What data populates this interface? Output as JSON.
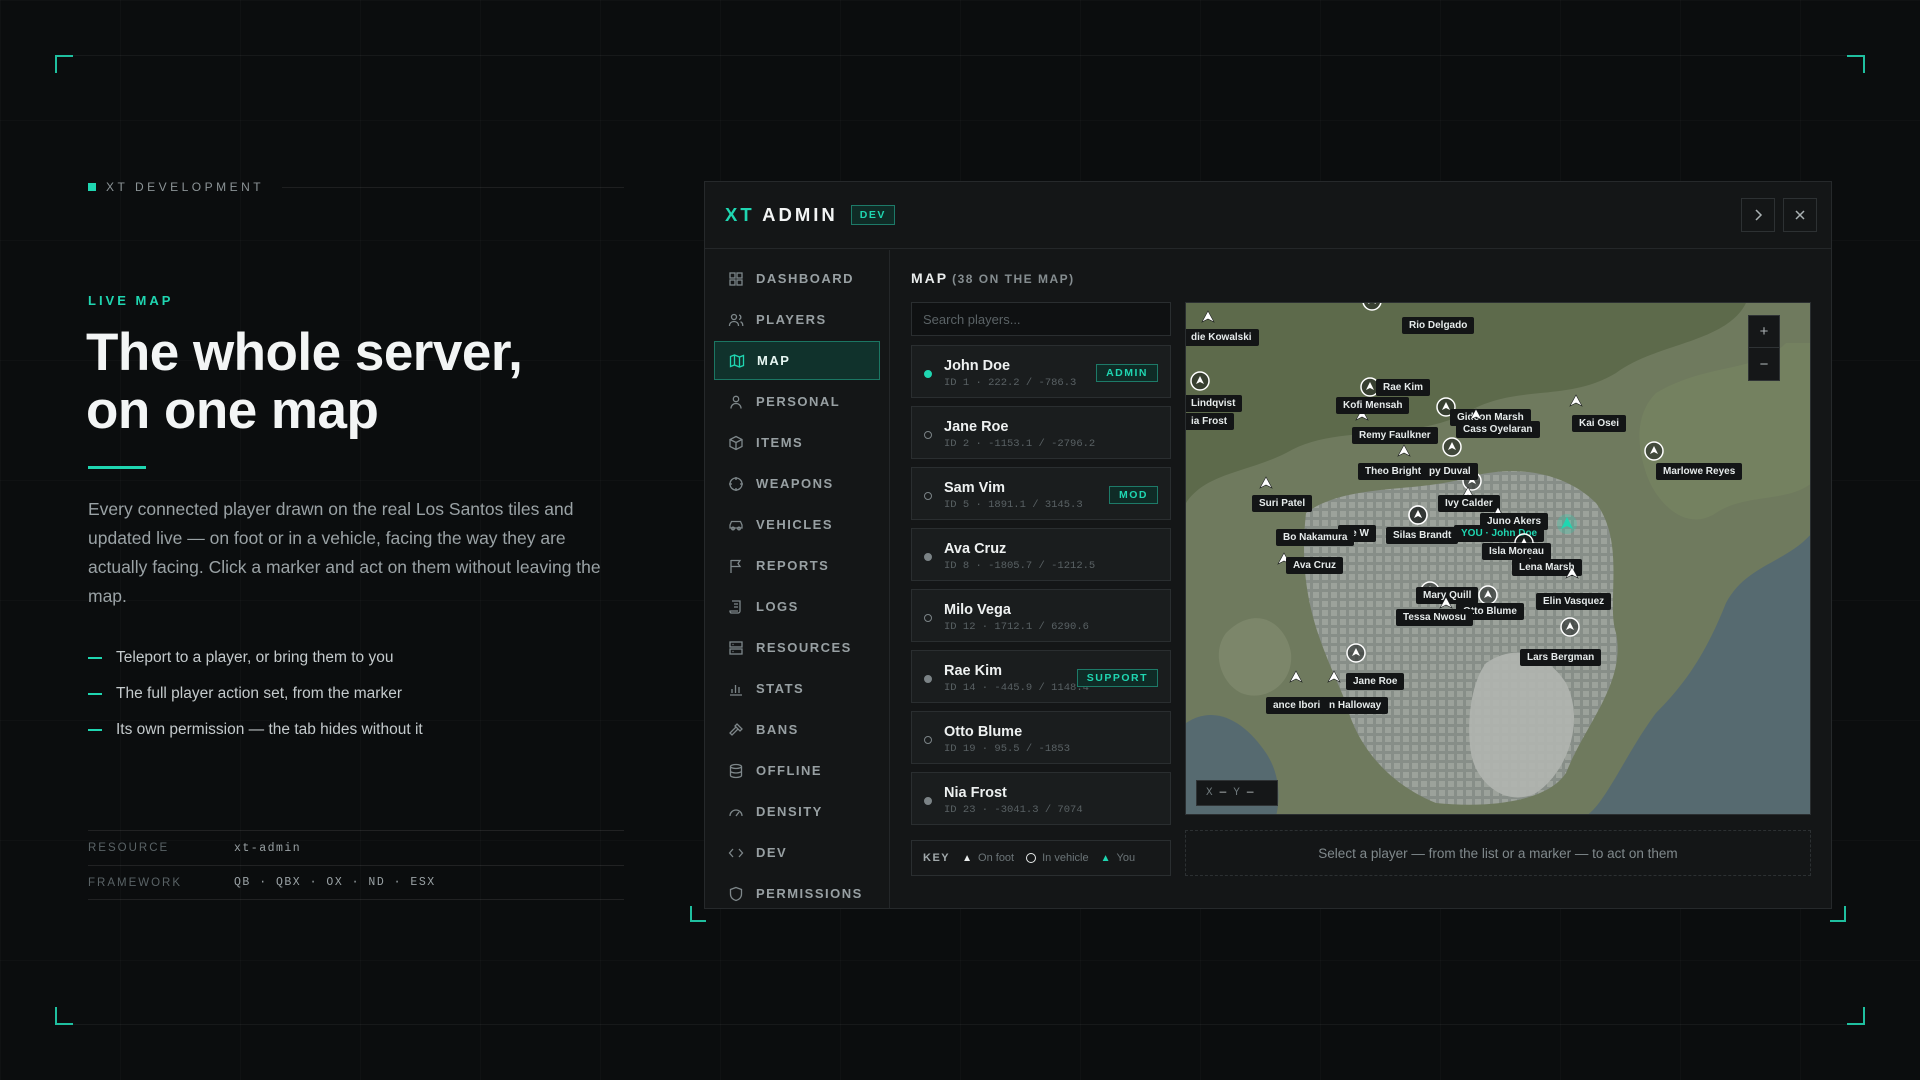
{
  "brand": {
    "label": "XT DEVELOPMENT"
  },
  "hero": {
    "eyebrow": "LIVE MAP",
    "headline_line1": "The whole server,",
    "headline_line2": "on one map",
    "lede": "Every connected player drawn on the real Los Santos tiles and updated live — on foot or in a vehicle, facing the way they are actually facing. Click a marker and act on them without leaving the map.",
    "bullets": [
      "Teleport to a player, or bring them to you",
      "The full player action set, from the marker",
      "Its own permission — the tab hides without it"
    ],
    "meta": [
      {
        "key": "RESOURCE",
        "value": "xt-admin"
      },
      {
        "key": "FRAMEWORK",
        "value": "QB · QBX · OX · ND · ESX"
      }
    ]
  },
  "window": {
    "logo_accent": "XT",
    "logo_rest": " ADMIN",
    "badge": "DEV",
    "next_icon": "chevron-right-icon",
    "close_icon": "close-icon"
  },
  "sidebar": {
    "items": [
      {
        "label": "DASHBOARD",
        "icon": "grid-icon"
      },
      {
        "label": "PLAYERS",
        "icon": "users-icon"
      },
      {
        "label": "MAP",
        "icon": "map-icon",
        "active": true
      },
      {
        "label": "PERSONAL",
        "icon": "person-icon"
      },
      {
        "label": "ITEMS",
        "icon": "box-icon"
      },
      {
        "label": "WEAPONS",
        "icon": "crosshair-icon"
      },
      {
        "label": "VEHICLES",
        "icon": "car-icon"
      },
      {
        "label": "REPORTS",
        "icon": "flag-icon"
      },
      {
        "label": "LOGS",
        "icon": "scroll-icon"
      },
      {
        "label": "RESOURCES",
        "icon": "server-icon"
      },
      {
        "label": "STATS",
        "icon": "bar-chart-icon"
      },
      {
        "label": "BANS",
        "icon": "hammer-icon"
      },
      {
        "label": "OFFLINE",
        "icon": "database-icon"
      },
      {
        "label": "DENSITY",
        "icon": "gauge-icon"
      },
      {
        "label": "DEV",
        "icon": "code-icon"
      },
      {
        "label": "PERMISSIONS",
        "icon": "shield-icon"
      }
    ]
  },
  "map_section": {
    "title": "MAP",
    "count": "(38 ON THE MAP)",
    "search_placeholder": "Search players...",
    "players": [
      {
        "name": "John Doe",
        "sub": "ID 1 · 222.2 / -786.3",
        "role": "ADMIN",
        "state": "on"
      },
      {
        "name": "Jane Roe",
        "sub": "ID 2 · -1153.1 / -2796.2",
        "role": "",
        "state": "veh"
      },
      {
        "name": "Sam Vim",
        "sub": "ID 5 · 1891.1 / 3145.3",
        "role": "MOD",
        "state": "veh"
      },
      {
        "name": "Ava Cruz",
        "sub": "ID 8 · -1805.7 / -1212.5",
        "role": "",
        "state": "foot"
      },
      {
        "name": "Milo Vega",
        "sub": "ID 12 · 1712.1 / 6290.6",
        "role": "",
        "state": "veh"
      },
      {
        "name": "Rae Kim",
        "sub": "ID 14 · -445.9 / 1148.4",
        "role": "SUPPORT",
        "state": "foot"
      },
      {
        "name": "Otto Blume",
        "sub": "ID 19 · 95.5 / -1853",
        "role": "",
        "state": "veh"
      },
      {
        "name": "Nia Frost",
        "sub": "ID 23 · -3041.3 / 7074",
        "role": "",
        "state": "foot"
      }
    ],
    "key": {
      "label": "KEY",
      "on_foot": "On foot",
      "in_vehicle": "In vehicle",
      "you": "You"
    },
    "zoom_in": "+",
    "zoom_out": "−",
    "coords": {
      "x_label": "X",
      "x_value": "—",
      "y_label": "Y",
      "y_value": "—"
    },
    "hint": "Select a player — from the list or a marker — to act on them",
    "markers": [
      {
        "label": "Rio Delgado",
        "kind": "veh"
      },
      {
        "label": "die Kowalski",
        "kind": "foot"
      },
      {
        "label": "Rae Kim",
        "kind": "veh"
      },
      {
        "label": "Lindqvist",
        "kind": "veh"
      },
      {
        "label": "Kofi Mensah",
        "kind": "foot"
      },
      {
        "label": "Gideon Marsh",
        "kind": "veh"
      },
      {
        "label": "ia Frost",
        "kind": "foot"
      },
      {
        "label": "Cass Oyelaran",
        "kind": "foot"
      },
      {
        "label": "Kai Osei",
        "kind": "foot"
      },
      {
        "label": "Remy Faulkner",
        "kind": "foot"
      },
      {
        "label": "Marlowe Reyes",
        "kind": "veh"
      },
      {
        "label": "Theo Bright",
        "kind": "veh"
      },
      {
        "label": "py Duval",
        "kind": "veh"
      },
      {
        "label": "Suri Patel",
        "kind": "foot"
      },
      {
        "label": "Ivy Calder",
        "kind": "foot"
      },
      {
        "label": "Juno Akers",
        "kind": "foot"
      },
      {
        "label": "ne W",
        "kind": "veh"
      },
      {
        "label": "Silas Brandt",
        "kind": "veh"
      },
      {
        "label": "YOU · John Doe",
        "kind": "you"
      },
      {
        "label": "Bo Nakamura",
        "kind": "foot"
      },
      {
        "label": "Isla Moreau",
        "kind": "veh"
      },
      {
        "label": "Ava Cruz",
        "kind": "foot"
      },
      {
        "label": "Lena Marsh",
        "kind": "foot"
      },
      {
        "label": "Mary Quill",
        "kind": "veh"
      },
      {
        "label": "Elin Vasquez",
        "kind": "foot"
      },
      {
        "label": "Otto Blume",
        "kind": "veh"
      },
      {
        "label": "Tessa Nwosu",
        "kind": "foot"
      },
      {
        "label": "Lars Bergman",
        "kind": "veh"
      },
      {
        "label": "Jane Roe",
        "kind": "veh"
      },
      {
        "label": "ance Ibori",
        "kind": "foot"
      },
      {
        "label": "n Halloway",
        "kind": "foot"
      }
    ]
  }
}
